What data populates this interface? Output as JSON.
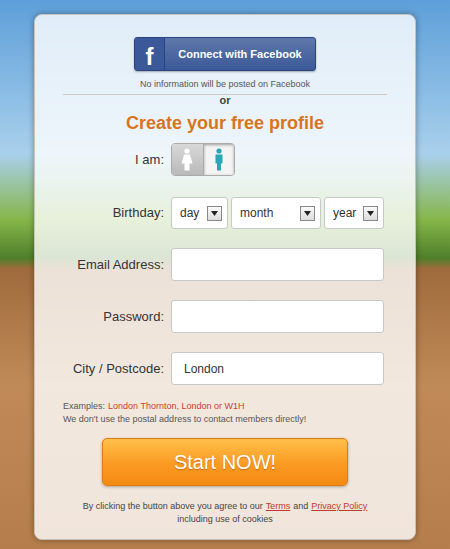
{
  "facebook": {
    "logo": "f",
    "label": "Connect with Facebook",
    "note": "No information will be posted on Facebook"
  },
  "divider": "or",
  "heading": "Create your free profile",
  "gender": {
    "label": "I am:",
    "options": [
      {
        "kind": "female",
        "selected": false
      },
      {
        "kind": "male",
        "selected": true
      }
    ]
  },
  "birthday": {
    "label": "Birthday:",
    "selects": [
      "day",
      "month",
      "year"
    ]
  },
  "fields": [
    {
      "label": "Email Address:",
      "value": "",
      "kind": "text"
    },
    {
      "label": "Password:",
      "value": "",
      "kind": "password"
    },
    {
      "label": "City / Postcode:",
      "value": "London",
      "kind": "text"
    }
  ],
  "hint": {
    "prefix": "Examples:",
    "examples": "London Thornton, London or W1H",
    "note": "We don't use the postal address to contact members directly!"
  },
  "submit": "Start NOW!",
  "legal": {
    "before": "By clicking the button above you agree to our",
    "terms": "Terms",
    "middle": "and",
    "privacy": "Privacy Policy",
    "after": "including use of cookies"
  }
}
